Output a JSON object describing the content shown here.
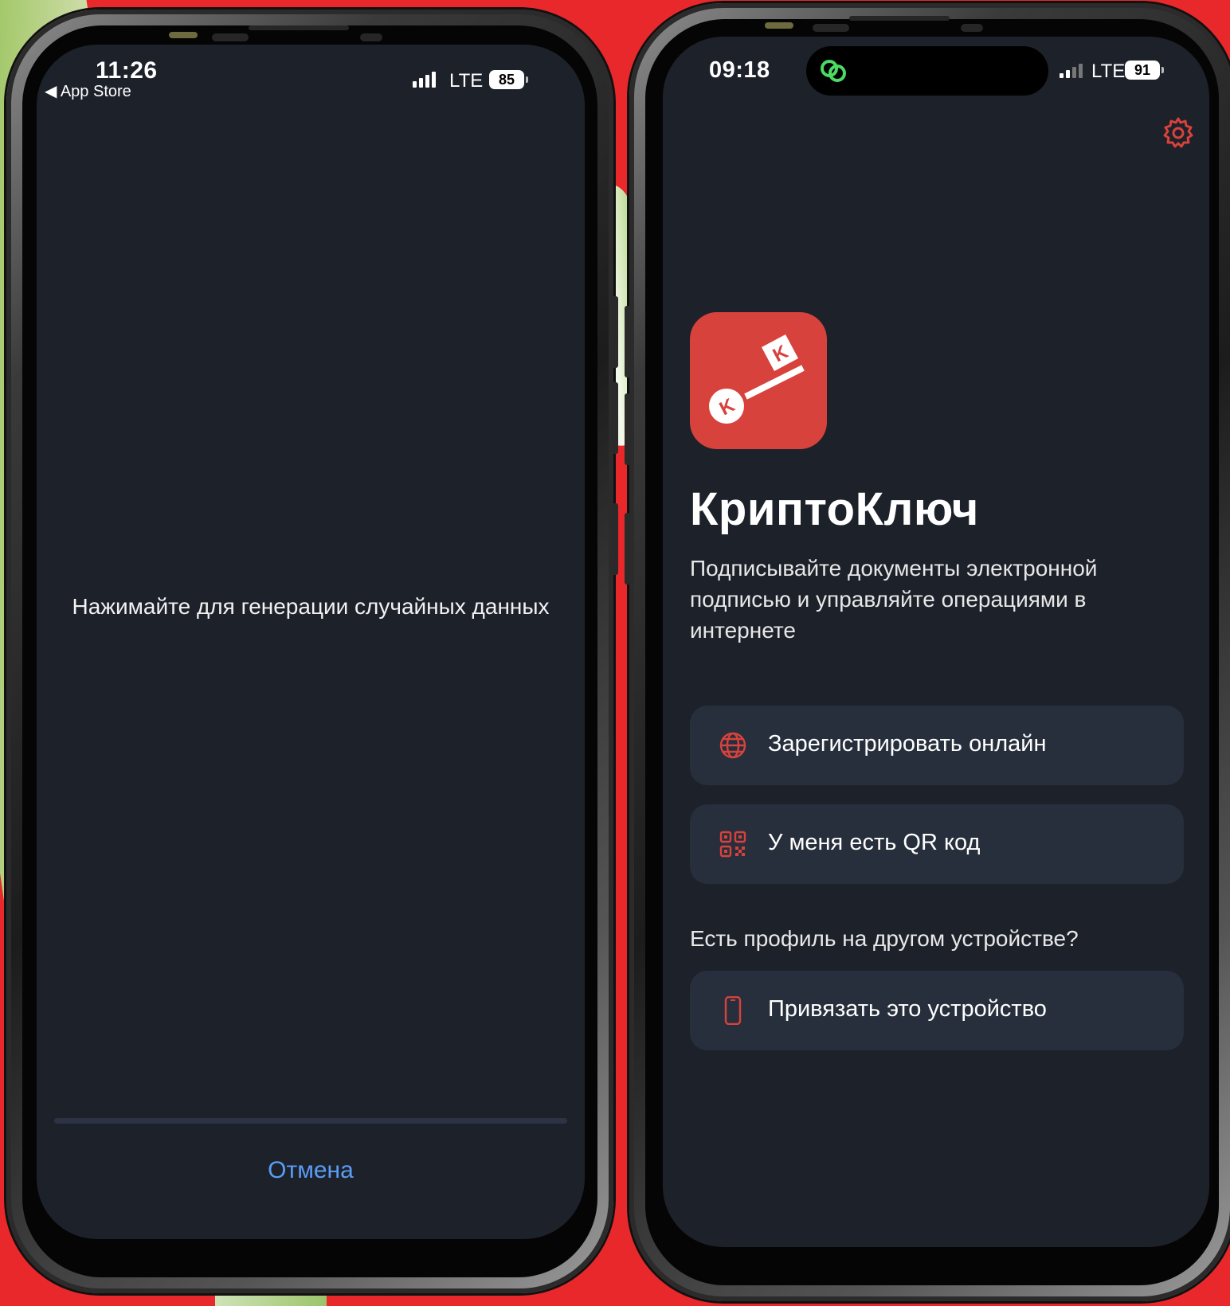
{
  "left_screen": {
    "status": {
      "time": "11:26",
      "back_label": "◀ App Store",
      "network": "LTE",
      "battery": "85"
    },
    "hint": "Нажимайте для генерации случайных данных",
    "progress": 0,
    "cancel_label": "Отмена"
  },
  "right_screen": {
    "status": {
      "time": "09:18",
      "network": "LTE",
      "battery": "91"
    },
    "settings_icon": "gear-icon",
    "app": {
      "title": "КриптоКлюч",
      "description": "Подписывайте документы электронной подписью и управляйте операциями в интернете",
      "logo_letter": "K"
    },
    "actions": {
      "register": {
        "label": "Зарегистрировать онлайн",
        "icon": "globe-icon"
      },
      "qr": {
        "label": "У меня есть QR код",
        "icon": "qr-code-icon"
      },
      "other_device_prompt": "Есть профиль на другом устройстве?",
      "link_device": {
        "label": "Привязать это устройство",
        "icon": "smartphone-icon"
      }
    }
  },
  "colors": {
    "background_red": "#e8282a",
    "screen_bg": "#1d212a",
    "button_bg": "#272f3c",
    "accent_red": "#d8423c",
    "link_blue": "#5a9df5"
  }
}
